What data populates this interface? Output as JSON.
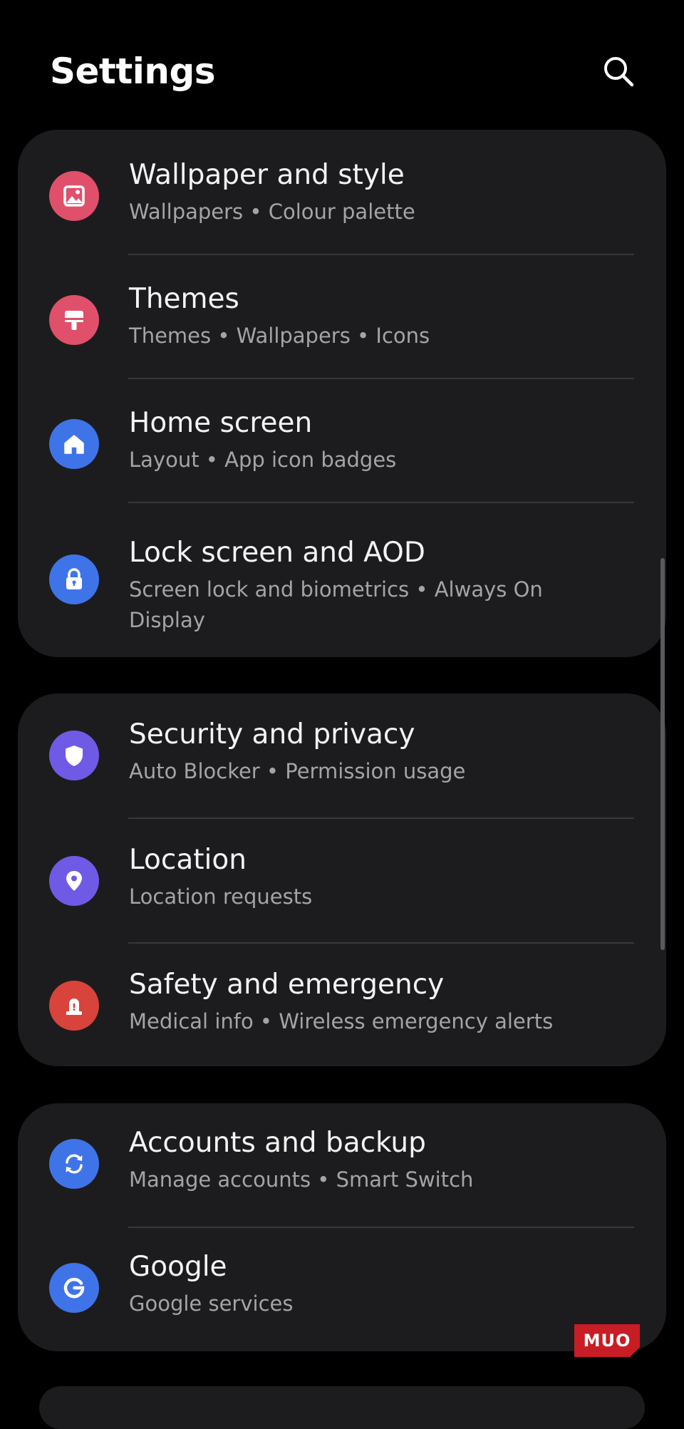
{
  "header": {
    "title": "Settings",
    "search_icon": "search-icon"
  },
  "groups": [
    {
      "items": [
        {
          "title": "Wallpaper and style",
          "subtitle": "Wallpapers  •  Colour palette",
          "icon": "wallpaper-icon",
          "color": "#e0506a"
        },
        {
          "title": "Themes",
          "subtitle": "Themes  •  Wallpapers  •  Icons",
          "icon": "paint-roller-icon",
          "color": "#e0506a"
        },
        {
          "title": "Home screen",
          "subtitle": "Layout  •  App icon badges",
          "icon": "home-icon",
          "color": "#3f74e8"
        },
        {
          "title": "Lock screen and AOD",
          "subtitle": "Screen lock and biometrics  •  Always On Display",
          "icon": "lock-icon",
          "color": "#3f74e8"
        }
      ]
    },
    {
      "items": [
        {
          "title": "Security and privacy",
          "subtitle": "Auto Blocker  •  Permission usage",
          "icon": "shield-icon",
          "color": "#6f5ae6"
        },
        {
          "title": "Location",
          "subtitle": "Location requests",
          "icon": "location-pin-icon",
          "color": "#6f5ae6"
        },
        {
          "title": "Safety and emergency",
          "subtitle": "Medical info  •  Wireless emergency alerts",
          "icon": "emergency-siren-icon",
          "color": "#d8433b"
        }
      ]
    },
    {
      "items": [
        {
          "title": "Accounts and backup",
          "subtitle": "Manage accounts  •  Smart Switch",
          "icon": "sync-icon",
          "color": "#3f74e8"
        },
        {
          "title": "Google",
          "subtitle": "Google services",
          "icon": "google-icon",
          "color": "#3f74e8"
        }
      ]
    }
  ],
  "watermark": "MUO"
}
